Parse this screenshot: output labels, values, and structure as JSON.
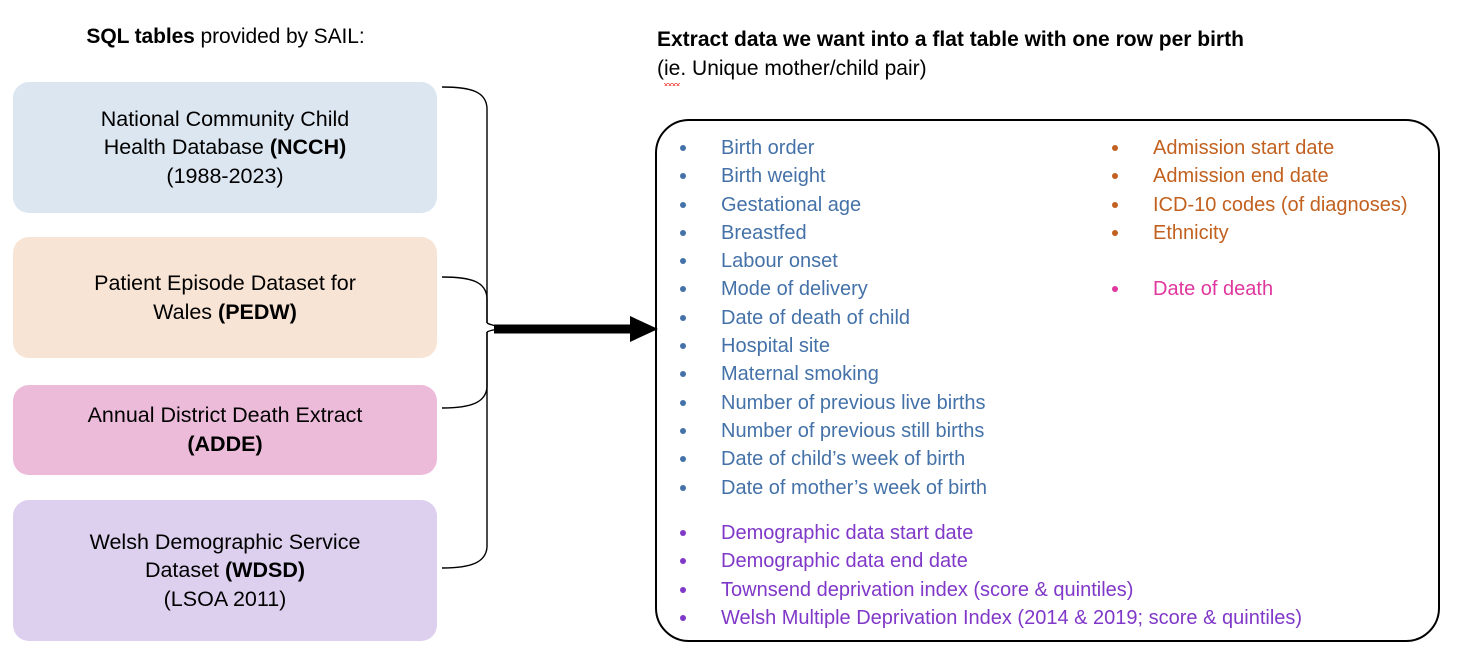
{
  "left": {
    "heading_bold": "SQL tables",
    "heading_rest": " provided by SAIL:",
    "boxes": [
      {
        "id": "ncch",
        "line1": "National Community Child",
        "line2_plain": "Health Database ",
        "line2_bold": "(NCCH)",
        "line3": "(1988-2023)",
        "color": "#dce6f1"
      },
      {
        "id": "pedw",
        "line1": "Patient Episode Dataset for",
        "line2_plain": "Wales ",
        "line2_bold": "(PEDW)",
        "line3": "",
        "color": "#f8e4d5"
      },
      {
        "id": "adde",
        "line1": "Annual District Death Extract",
        "line2_plain": "",
        "line2_bold": "(ADDE)",
        "line3": "",
        "color": "#edbbda"
      },
      {
        "id": "wdsd",
        "line1": "Welsh Demographic Service",
        "line2_plain": "Dataset ",
        "line2_bold": "(WDSD)",
        "line3": "(LSOA 2011)",
        "color": "#ddd0ef"
      }
    ]
  },
  "right": {
    "heading_bold": "Extract data we want into a flat table with one row per birth",
    "sub_prefix": "(",
    "sub_misspelled": "ie",
    "sub_rest": ". Unique mother/child pair)",
    "groups": [
      {
        "id": "blue",
        "color": "#4472a8",
        "items": [
          "Birth order",
          "Birth weight",
          "Gestational age",
          "Breastfed",
          "Labour onset",
          "Mode of delivery",
          "Date of death of child",
          "Hospital site",
          "Maternal smoking",
          "Number of previous live births",
          "Number of previous still births",
          "Date of child’s week of birth",
          "Date of mother’s week of birth"
        ]
      },
      {
        "id": "purple",
        "color": "#8038c8",
        "items": [
          "Demographic data start date",
          "Demographic data end date",
          "Townsend deprivation index (score & quintiles)",
          "Welsh Multiple Deprivation Index (2014 & 2019; score & quintiles)"
        ]
      },
      {
        "id": "orange",
        "color": "#c2611f",
        "items": [
          "Admission start date",
          "Admission end date",
          "ICD-10 codes (of diagnoses)",
          "Ethnicity"
        ]
      },
      {
        "id": "pink",
        "color": "#e0379e",
        "items": [
          "Date of death"
        ]
      }
    ]
  },
  "connector": {
    "arrow_color": "#000000",
    "brace_color": "#000000"
  }
}
